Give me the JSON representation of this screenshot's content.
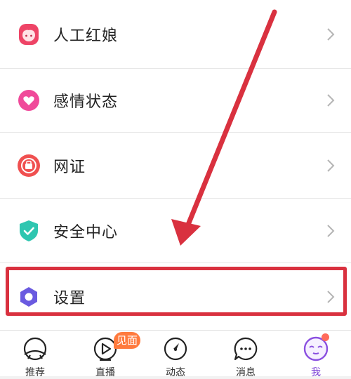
{
  "menu": {
    "items": [
      {
        "label": "人工红娘",
        "icon": "matchmaker-icon",
        "color": "#ee4466"
      },
      {
        "label": "感情状态",
        "icon": "heart-icon",
        "color": "#f04a9a"
      },
      {
        "label": "网证",
        "icon": "id-badge-icon",
        "color": "#f05050"
      },
      {
        "label": "安全中心",
        "icon": "shield-icon",
        "color": "#2fc6b0"
      },
      {
        "label": "设置",
        "icon": "gear-icon",
        "color": "#6a5ae0"
      }
    ]
  },
  "annotation": {
    "color": "#d9313f"
  },
  "tabbar": {
    "tabs": [
      {
        "label": "推荐",
        "icon": "planet-icon"
      },
      {
        "label": "直播",
        "icon": "play-icon",
        "badge": "见面"
      },
      {
        "label": "动态",
        "icon": "compass-icon"
      },
      {
        "label": "消息",
        "icon": "chat-icon"
      },
      {
        "label": "我",
        "icon": "avatar-face-icon",
        "active": true
      }
    ],
    "active_color": "#7b3fd6",
    "badge_color": "#ff7a3d"
  }
}
